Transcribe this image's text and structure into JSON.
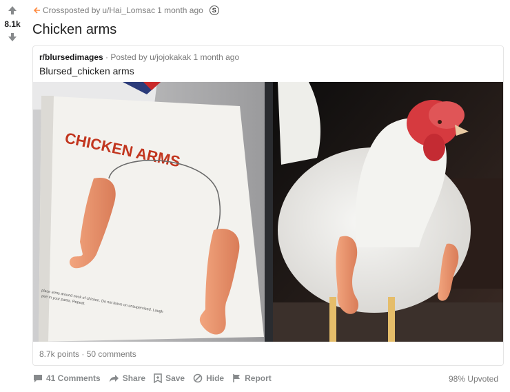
{
  "vote": {
    "score": "8.1k"
  },
  "crosspost": {
    "prefix": "Crossposted by ",
    "user": "u/Hai_Lomsac",
    "time": " 1 month ago",
    "award_glyph": "S"
  },
  "post": {
    "title": "Chicken arms"
  },
  "original": {
    "subreddit": "r/blursedimages",
    "posted_by": " · Posted by u/jojokakak 1 month ago",
    "title": "Blursed_chicken arms",
    "points": "8.7k points",
    "comments": "50 comments"
  },
  "image": {
    "package_text": "CHICKEN ARMS",
    "fine_print_1": "place arms around neck of chicken. Do not leave on unsupervised. Laugh",
    "fine_print_2": "pee in your pants. Repeat."
  },
  "actions": {
    "comments": "41 Comments",
    "share": "Share",
    "save": "Save",
    "hide": "Hide",
    "report": "Report"
  },
  "upvoted": "98% Upvoted",
  "icons": {
    "upvote": "arrow-up-icon",
    "downvote": "arrow-down-icon",
    "crosspost": "crosspost-icon",
    "comment": "comment-icon",
    "share": "share-icon",
    "save": "bookmark-icon",
    "hide": "hide-icon",
    "report": "flag-icon"
  }
}
